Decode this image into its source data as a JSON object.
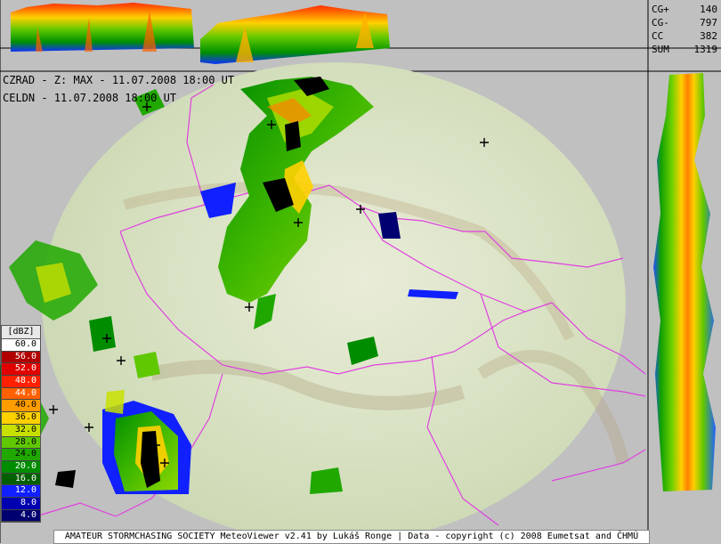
{
  "header": {
    "line1": "CZRAD - Z: MAX - 11.07.2008 18:00 UT",
    "line2": "CELDN - 11.07.2008 18:00 UT"
  },
  "lightning_stats": [
    {
      "label": "CG+",
      "value": "140"
    },
    {
      "label": "CG-",
      "value": "797"
    },
    {
      "label": "CC",
      "value": "382"
    },
    {
      "label": "SUM",
      "value": "1319"
    }
  ],
  "legend": {
    "unit": "[dBZ]",
    "levels": [
      {
        "value": "60.0",
        "color": "#ffffff",
        "text": "#000000"
      },
      {
        "value": "56.0",
        "color": "#b00000",
        "text": "#ffffff"
      },
      {
        "value": "52.0",
        "color": "#e00000",
        "text": "#ffffff"
      },
      {
        "value": "48.0",
        "color": "#ff2000",
        "text": "#ffffff"
      },
      {
        "value": "44.0",
        "color": "#ff6000",
        "text": "#ffffff"
      },
      {
        "value": "40.0",
        "color": "#ff9c00",
        "text": "#000000"
      },
      {
        "value": "36.0",
        "color": "#ffd000",
        "text": "#000000"
      },
      {
        "value": "32.0",
        "color": "#c8e000",
        "text": "#000000"
      },
      {
        "value": "28.0",
        "color": "#60c800",
        "text": "#000000"
      },
      {
        "value": "24.0",
        "color": "#20a800",
        "text": "#000000"
      },
      {
        "value": "20.0",
        "color": "#008c00",
        "text": "#ffffff"
      },
      {
        "value": "16.0",
        "color": "#006000",
        "text": "#ffffff"
      },
      {
        "value": "12.0",
        "color": "#1020ff",
        "text": "#ffffff"
      },
      {
        "value": "8.0",
        "color": "#0000b0",
        "text": "#ffffff"
      },
      {
        "value": "4.0",
        "color": "#000070",
        "text": "#ffffff"
      }
    ]
  },
  "footer": "AMATEUR STORMCHASING SOCIETY MeteoViewer v2.41 by Lukáš Ronge | Data - copyright (c) 2008 Eumetsat and ČHMÚ"
}
